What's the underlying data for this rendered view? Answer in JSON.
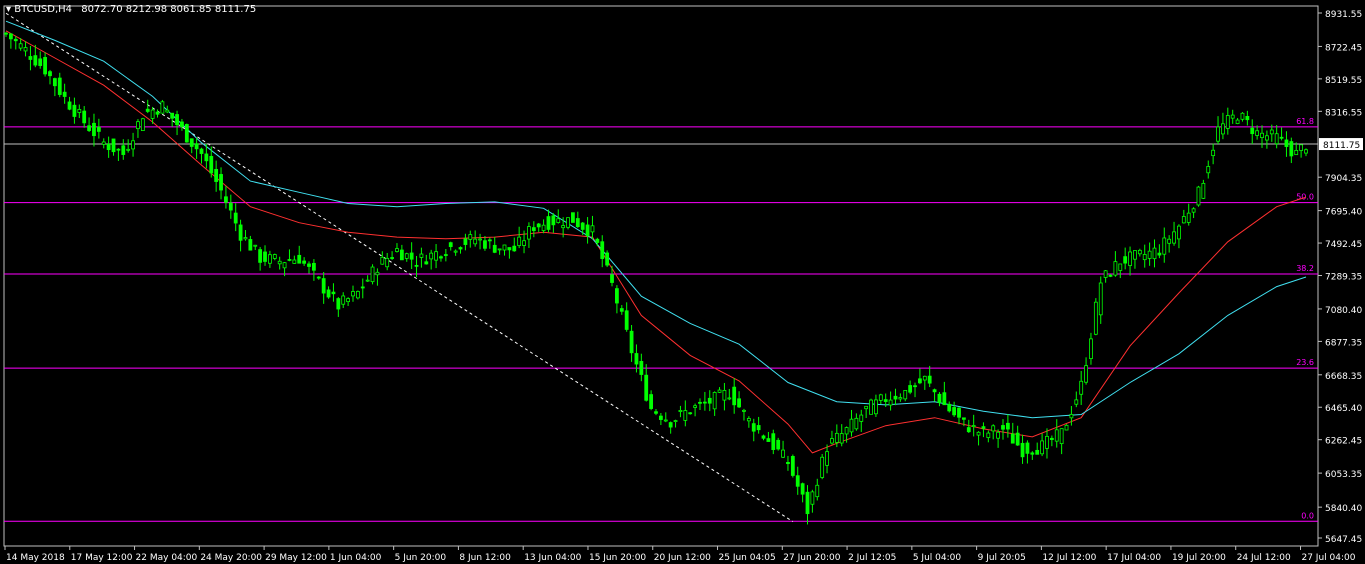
{
  "header": {
    "symbol": "BTCUSD,H4",
    "open": "8072.70",
    "high": "8212.98",
    "low": "8061.85",
    "close": "8111.75",
    "menu_icon": "triangle-down-icon"
  },
  "colors": {
    "background": "#000000",
    "candle": "#00ff00",
    "ma_fast": "#ff3030",
    "ma_slow": "#40e0f0",
    "fib": "#ff00ff",
    "price_line": "#c0c0c0",
    "axis_text": "#ffffff"
  },
  "chart_data": {
    "type": "line",
    "title": "BTCUSD,H4",
    "ylim": [
      5647.45,
      8931.55
    ],
    "y_ticks": [
      "8931.55",
      "8722.45",
      "8519.55",
      "8316.55",
      "7904.35",
      "7695.40",
      "7492.45",
      "7289.35",
      "7080.40",
      "6877.35",
      "6668.35",
      "6465.40",
      "6262.45",
      "6053.35",
      "5840.40",
      "5647.45"
    ],
    "x_ticks": [
      "14 May 2018",
      "17 May 12:00",
      "22 May 04:00",
      "24 May 20:00",
      "29 May 12:00",
      "1 Jun 04:00",
      "5 Jun 20:00",
      "8 Jun 12:00",
      "13 Jun 04:00",
      "15 Jun 20:00",
      "20 Jun 12:00",
      "25 Jun 04:05",
      "27 Jun 20:00",
      "2 Jul 12:05",
      "5 Jul 04:00",
      "9 Jul 20:05",
      "12 Jul 12:00",
      "17 Jul 04:00",
      "19 Jul 20:00",
      "24 Jul 12:00",
      "27 Jul 04:00"
    ],
    "current_price": "8111.75",
    "fib_levels": [
      {
        "label": "61.8",
        "value": 8219
      },
      {
        "label": "50.0",
        "value": 7745
      },
      {
        "label": "38.2",
        "value": 7299
      },
      {
        "label": "23.6",
        "value": 6710
      },
      {
        "label": "0.0",
        "value": 5752
      }
    ],
    "trendline": {
      "from": [
        0,
        8930
      ],
      "to": [
        161,
        5750
      ]
    },
    "close_path": [
      [
        0,
        8800
      ],
      [
        4,
        8700
      ],
      [
        8,
        8580
      ],
      [
        12,
        8400
      ],
      [
        16,
        8250
      ],
      [
        20,
        8120
      ],
      [
        24,
        8050
      ],
      [
        28,
        8300
      ],
      [
        32,
        8350
      ],
      [
        36,
        8200
      ],
      [
        40,
        8050
      ],
      [
        44,
        7820
      ],
      [
        48,
        7550
      ],
      [
        52,
        7400
      ],
      [
        56,
        7380
      ],
      [
        60,
        7400
      ],
      [
        64,
        7250
      ],
      [
        68,
        7100
      ],
      [
        72,
        7180
      ],
      [
        76,
        7350
      ],
      [
        80,
        7450
      ],
      [
        84,
        7380
      ],
      [
        88,
        7430
      ],
      [
        92,
        7480
      ],
      [
        96,
        7520
      ],
      [
        100,
        7470
      ],
      [
        104,
        7450
      ],
      [
        108,
        7600
      ],
      [
        112,
        7630
      ],
      [
        116,
        7640
      ],
      [
        120,
        7560
      ],
      [
        124,
        7230
      ],
      [
        128,
        6820
      ],
      [
        132,
        6460
      ],
      [
        136,
        6380
      ],
      [
        140,
        6450
      ],
      [
        144,
        6500
      ],
      [
        148,
        6560
      ],
      [
        152,
        6380
      ],
      [
        156,
        6260
      ],
      [
        160,
        6120
      ],
      [
        164,
        5820
      ],
      [
        168,
        6220
      ],
      [
        172,
        6320
      ],
      [
        176,
        6450
      ],
      [
        180,
        6520
      ],
      [
        184,
        6560
      ],
      [
        188,
        6640
      ],
      [
        192,
        6480
      ],
      [
        196,
        6360
      ],
      [
        200,
        6300
      ],
      [
        204,
        6330
      ],
      [
        208,
        6200
      ],
      [
        212,
        6220
      ],
      [
        216,
        6300
      ],
      [
        220,
        6600
      ],
      [
        224,
        7250
      ],
      [
        228,
        7380
      ],
      [
        232,
        7410
      ],
      [
        236,
        7450
      ],
      [
        240,
        7600
      ],
      [
        244,
        7800
      ],
      [
        248,
        8200
      ],
      [
        252,
        8300
      ],
      [
        256,
        8180
      ],
      [
        260,
        8150
      ],
      [
        264,
        8050
      ],
      [
        266,
        8111
      ]
    ],
    "series": [
      {
        "name": "ma_fast",
        "values": [
          [
            0,
            8820
          ],
          [
            10,
            8650
          ],
          [
            20,
            8480
          ],
          [
            30,
            8250
          ],
          [
            40,
            7980
          ],
          [
            50,
            7720
          ],
          [
            60,
            7620
          ],
          [
            70,
            7560
          ],
          [
            80,
            7530
          ],
          [
            90,
            7520
          ],
          [
            100,
            7530
          ],
          [
            110,
            7560
          ],
          [
            120,
            7530
          ],
          [
            130,
            7040
          ],
          [
            140,
            6790
          ],
          [
            150,
            6630
          ],
          [
            160,
            6360
          ],
          [
            165,
            6180
          ],
          [
            170,
            6240
          ],
          [
            180,
            6350
          ],
          [
            190,
            6400
          ],
          [
            200,
            6330
          ],
          [
            210,
            6280
          ],
          [
            220,
            6400
          ],
          [
            230,
            6850
          ],
          [
            240,
            7180
          ],
          [
            250,
            7500
          ],
          [
            260,
            7720
          ],
          [
            266,
            7780
          ]
        ]
      },
      {
        "name": "ma_slow",
        "values": [
          [
            0,
            8880
          ],
          [
            10,
            8760
          ],
          [
            20,
            8630
          ],
          [
            30,
            8410
          ],
          [
            40,
            8120
          ],
          [
            50,
            7880
          ],
          [
            60,
            7810
          ],
          [
            70,
            7740
          ],
          [
            80,
            7720
          ],
          [
            90,
            7740
          ],
          [
            100,
            7750
          ],
          [
            110,
            7710
          ],
          [
            120,
            7520
          ],
          [
            130,
            7160
          ],
          [
            140,
            6990
          ],
          [
            150,
            6860
          ],
          [
            160,
            6620
          ],
          [
            170,
            6500
          ],
          [
            180,
            6480
          ],
          [
            190,
            6500
          ],
          [
            200,
            6440
          ],
          [
            210,
            6400
          ],
          [
            220,
            6420
          ],
          [
            230,
            6620
          ],
          [
            240,
            6800
          ],
          [
            250,
            7040
          ],
          [
            260,
            7220
          ],
          [
            266,
            7280
          ]
        ]
      }
    ]
  }
}
